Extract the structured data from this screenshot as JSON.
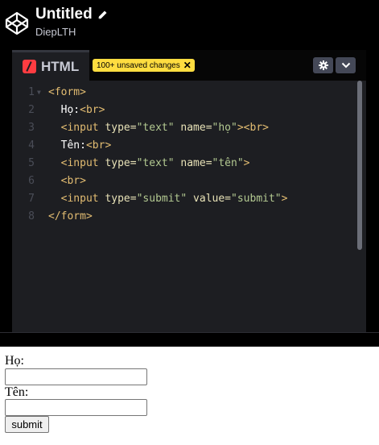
{
  "header": {
    "title": "Untitled",
    "author": "DiepLTH",
    "logo_icon": "codepen-logo-icon",
    "edit_icon": "pencil-icon"
  },
  "editor": {
    "tab_label": "HTML",
    "unsaved_badge": "100+ unsaved changes",
    "unsaved_close": "✕",
    "settings_icon": "gear-icon",
    "collapse_icon": "chevron-down-icon",
    "accent_color": "#ff3c41",
    "badge_color": "#ffdd40",
    "lines": [
      {
        "num": "1",
        "parts": [
          {
            "c": "t-tag",
            "t": "<form>"
          }
        ]
      },
      {
        "num": "2",
        "parts": [
          {
            "c": "t-txt",
            "t": "  Họ:"
          },
          {
            "c": "t-tag",
            "t": "<br>"
          }
        ]
      },
      {
        "num": "3",
        "parts": [
          {
            "c": "t-tag",
            "t": "  <input "
          },
          {
            "c": "t-attr",
            "t": "type="
          },
          {
            "c": "t-val",
            "t": "\"text\""
          },
          {
            "c": "t-attr",
            "t": " name="
          },
          {
            "c": "t-val",
            "t": "\"họ\""
          },
          {
            "c": "t-tag",
            "t": "><br>"
          }
        ]
      },
      {
        "num": "4",
        "parts": [
          {
            "c": "t-txt",
            "t": "  Tên:"
          },
          {
            "c": "t-tag",
            "t": "<br>"
          }
        ]
      },
      {
        "num": "5",
        "parts": [
          {
            "c": "t-tag",
            "t": "  <input "
          },
          {
            "c": "t-attr",
            "t": "type="
          },
          {
            "c": "t-val",
            "t": "\"text\""
          },
          {
            "c": "t-attr",
            "t": " name="
          },
          {
            "c": "t-val",
            "t": "\"tên\""
          },
          {
            "c": "t-tag",
            "t": ">"
          }
        ]
      },
      {
        "num": "6",
        "parts": [
          {
            "c": "t-tag",
            "t": "  <br>"
          }
        ]
      },
      {
        "num": "7",
        "parts": [
          {
            "c": "t-tag",
            "t": "  <input "
          },
          {
            "c": "t-attr",
            "t": "type="
          },
          {
            "c": "t-val",
            "t": "\"submit\""
          },
          {
            "c": "t-attr",
            "t": " value="
          },
          {
            "c": "t-val",
            "t": "\"submit\""
          },
          {
            "c": "t-tag",
            "t": ">"
          }
        ]
      },
      {
        "num": "8",
        "parts": [
          {
            "c": "t-tag",
            "t": "</form>"
          }
        ]
      }
    ]
  },
  "result": {
    "label_ho": "Họ:",
    "input_ho_value": "",
    "label_ten": "Tên:",
    "input_ten_value": "",
    "submit_label": "submit"
  }
}
